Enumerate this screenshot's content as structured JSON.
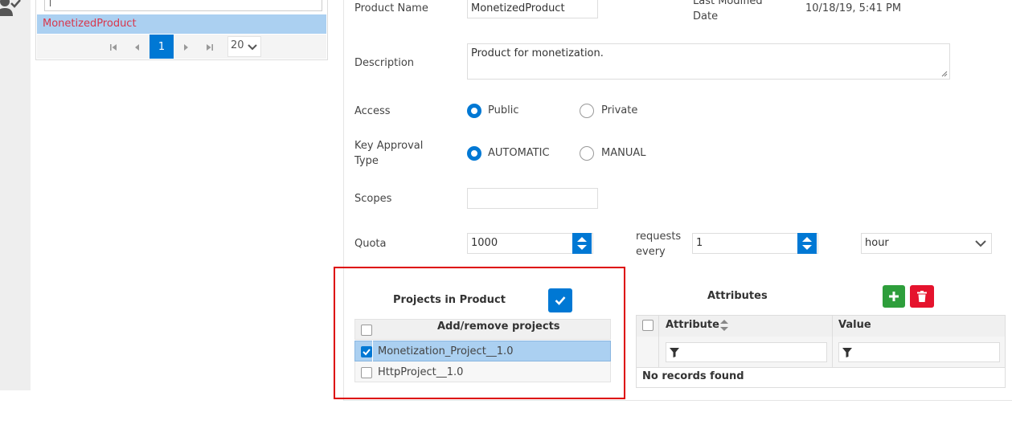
{
  "colors": {
    "accent": "#0078d4",
    "selected_row": "#abd0f1",
    "danger": "#e5132d",
    "success": "#2e9e3b",
    "highlight_border": "#dd0000"
  },
  "left_list": {
    "selected_item": "MonetizedProduct",
    "pager": {
      "current_page": "1",
      "page_size": "20"
    }
  },
  "form": {
    "product_name": {
      "label": "Product Name",
      "value": "MonetizedProduct"
    },
    "last_modified": {
      "label_line1": "Last Modified",
      "label_line2": "Date",
      "value": "10/18/19, 5:41 PM"
    },
    "description": {
      "label": "Description",
      "value": "Product for monetization."
    },
    "access": {
      "label": "Access",
      "options": [
        "Public",
        "Private"
      ],
      "selected": "Public"
    },
    "key_approval": {
      "label_line1": "Key Approval",
      "label_line2": "Type",
      "options": [
        "AUTOMATIC",
        "MANUAL"
      ],
      "selected": "AUTOMATIC"
    },
    "scopes": {
      "label": "Scopes",
      "value": ""
    },
    "quota": {
      "label": "Quota",
      "value": "1000",
      "requests_label_line1": "requests",
      "requests_label_line2": "every",
      "interval_value": "1",
      "unit": "hour"
    }
  },
  "projects": {
    "title": "Projects in Product",
    "column_header": "Add/remove projects",
    "rows": [
      {
        "name": "Monetization_Project__1.0",
        "checked": true
      },
      {
        "name": "HttpProject__1.0",
        "checked": false
      }
    ]
  },
  "attributes": {
    "title": "Attributes",
    "columns": [
      "Attribute",
      "Value"
    ],
    "empty_message": "No records found"
  }
}
